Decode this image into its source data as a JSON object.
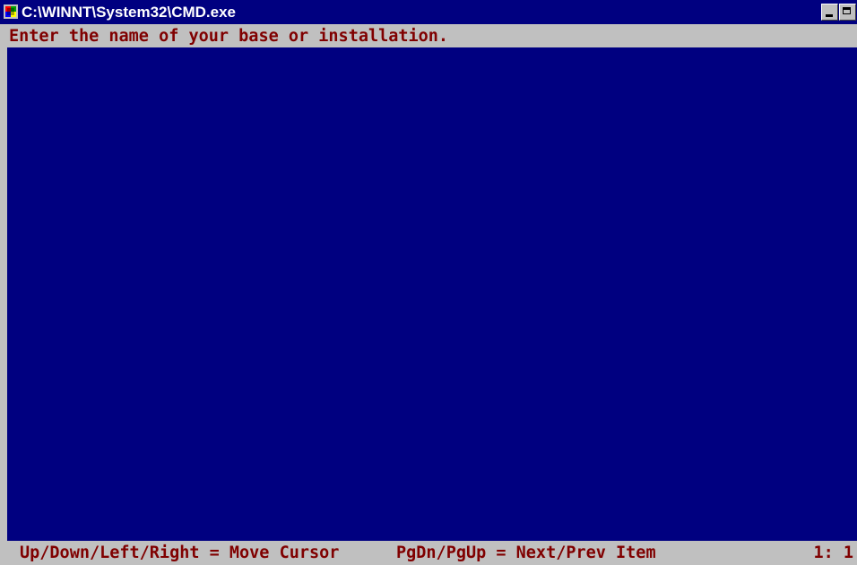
{
  "window": {
    "title": "C:\\WINNT\\System32\\CMD.exe",
    "icon": "cmd-app-icon"
  },
  "prompt": {
    "text": "Enter the name of your base or installation."
  },
  "status": {
    "navigation_hint": "Up/Down/Left/Right = Move Cursor",
    "paging_hint": "PgDn/PgUp = Next/Prev Item",
    "position": "1: 1"
  },
  "colors": {
    "title_bg": "#000080",
    "console_bg": "#000080",
    "bar_bg": "#c0c0c0",
    "text": "#800000"
  }
}
